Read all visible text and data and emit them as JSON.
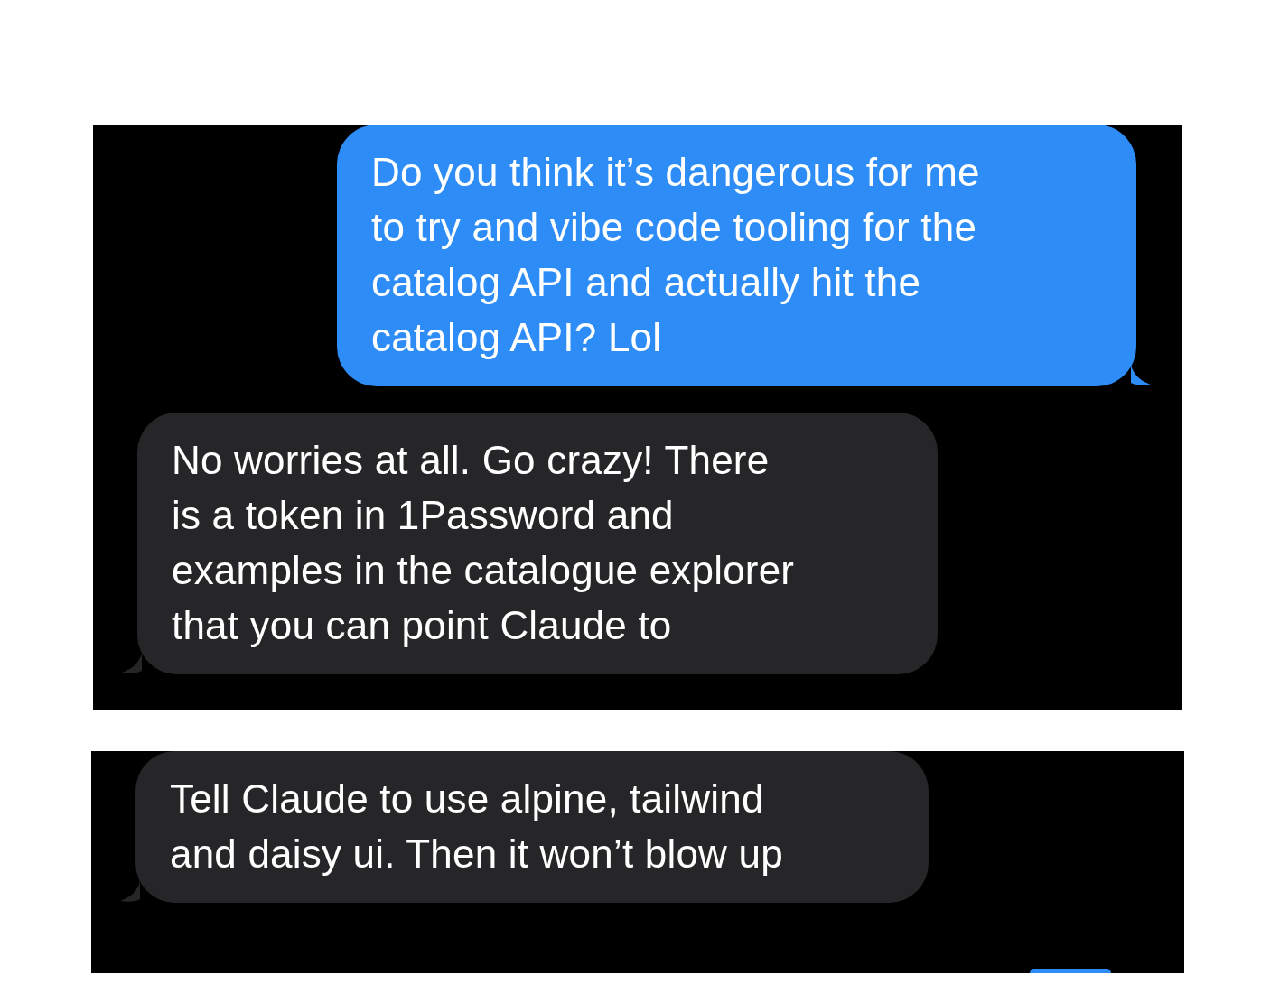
{
  "panels": [
    {
      "messages": [
        {
          "kind": "sent",
          "text": "Do you think it’s dangerous for me\nto try and vibe code tooling for the\ncatalog API and actually hit the\ncatalog API? Lol"
        },
        {
          "kind": "received",
          "text": "No worries at all. Go crazy! There\nis a token in 1Password and\nexamples in the catalogue explorer\nthat you can point Claude to"
        }
      ]
    },
    {
      "messages": [
        {
          "kind": "received",
          "text": "Tell Claude to use alpine, tailwind\nand daisy ui. Then it won’t blow up"
        },
        {
          "kind": "cut_off"
        }
      ]
    }
  ]
}
